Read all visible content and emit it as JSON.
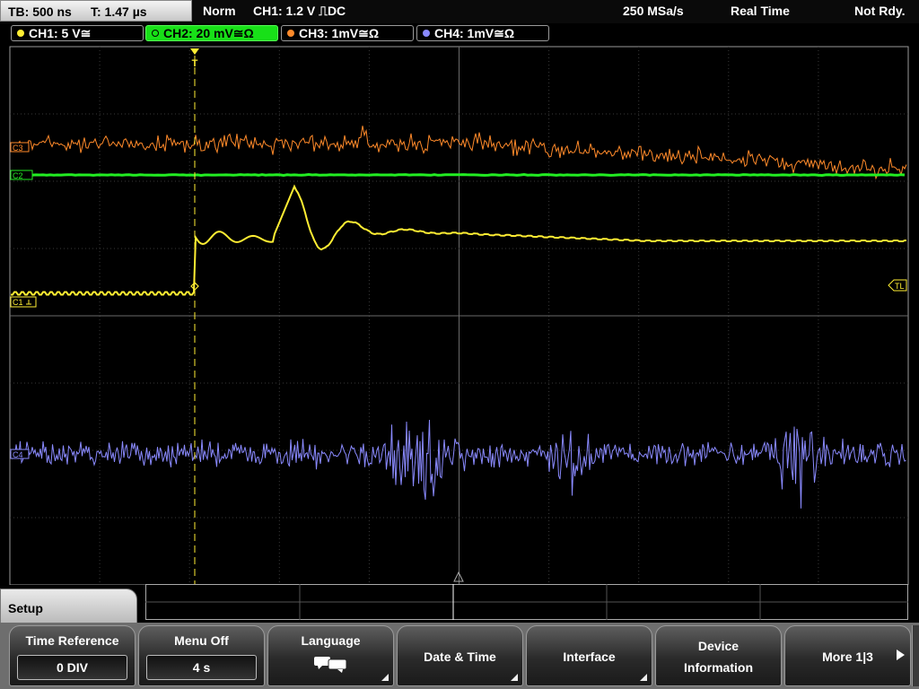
{
  "status_bar": {
    "timebase": "TB: 500 ns",
    "trigger_time": "T: 1.47 µs",
    "mode": "Norm",
    "trigger_info": "CH1: 1.2 V ⎍DC",
    "sample_rate": "250 MSa/s",
    "acq_mode": "Real Time",
    "state": "Not Rdy."
  },
  "channels": [
    {
      "label": "CH1: 5 V≅",
      "color": "#ffee33",
      "active": false
    },
    {
      "label": "CH2: 20 mV≅Ω",
      "color": "#22ee22",
      "active": true
    },
    {
      "label": "CH3: 1mV≅Ω",
      "color": "#ff8a2a",
      "active": false
    },
    {
      "label": "CH4: 1mV≅Ω",
      "color": "#8a8aff",
      "active": false
    }
  ],
  "screen": {
    "markers": {
      "ch1": "C1",
      "ch2": "C2",
      "ch3": "C3",
      "ch4": "C4",
      "trigger_level": "TL",
      "trigger_pos": "T"
    }
  },
  "menu": {
    "title": "Setup",
    "buttons": [
      {
        "label": "Time Reference",
        "value": "0 DIV"
      },
      {
        "label": "Menu Off",
        "value": "4 s"
      },
      {
        "label": "Language",
        "icon": "speech-bubbles-icon"
      },
      {
        "label": "Date & Time"
      },
      {
        "label": "Interface"
      },
      {
        "label_line1": "Device",
        "label_line2": "Information"
      },
      {
        "label": "More 1|3"
      }
    ]
  }
}
